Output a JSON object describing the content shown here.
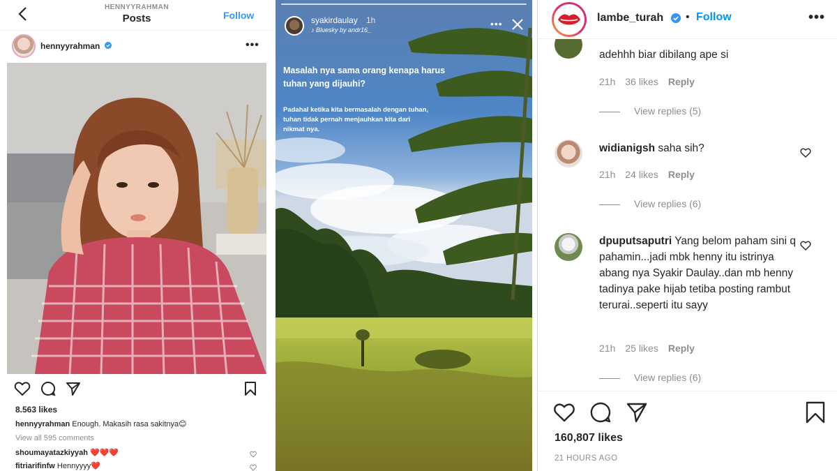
{
  "left_post": {
    "header_username": "HENNYYRAHMAN",
    "header_title": "Posts",
    "follow_label": "Follow",
    "username": "hennyyrahman",
    "likes": "8.563 likes",
    "caption_user": "hennyyrahman",
    "caption_text": " Enough. Makasih rasa sakitnya😊",
    "view_all": "View all 595 comments",
    "comments": [
      {
        "user": "shoumayatazkiyyah",
        "text": " ❤️❤️❤️"
      },
      {
        "user": "fitriarifinfw",
        "text": " Hennyyyy❤️"
      }
    ],
    "icons": [
      "back-arrow-icon",
      "verified-badge-icon",
      "more-options-icon",
      "heart-icon",
      "comment-icon",
      "share-icon",
      "bookmark-icon"
    ]
  },
  "story": {
    "username": "syakirdaulay",
    "time": "1h",
    "music": "♪ Bluesky by andr16_",
    "headline": "Masalah nya sama orang kenapa harus tuhan yang dijauhi?",
    "body": "Padahal ketika kita bermasalah dengan tuhan, tuhan tidak pernah menjauhkan kita dari nikmat nya.",
    "icons": [
      "more-options-icon",
      "close-icon"
    ]
  },
  "right_post": {
    "username": "lambe_turah",
    "dot": "•",
    "follow_label": "Follow",
    "comments": [
      {
        "user": "",
        "text": "adehhh biar dibilang ape si",
        "time": "21h",
        "likes": "36 likes",
        "reply": "Reply",
        "view_replies": "View replies (5)"
      },
      {
        "user": "widianigsh",
        "text": " saha sih?",
        "time": "21h",
        "likes": "24 likes",
        "reply": "Reply",
        "view_replies": "View replies (6)"
      },
      {
        "user": "dpuputsaputri",
        "text": " Yang belom paham sini q pahamin...jadi mbk henny itu istrinya abang nya Syakir Daulay..dan mb henny tadinya pake hijab tetiba posting rambut terurai..seperti itu sayy",
        "time": "21h",
        "likes": "25 likes",
        "reply": "Reply",
        "view_replies": "View replies (6)"
      }
    ],
    "likes": "160,807 likes",
    "time_ago": "21 HOURS AGO",
    "icons": [
      "verified-badge-icon",
      "more-options-icon",
      "heart-icon",
      "comment-icon",
      "share-icon",
      "bookmark-icon"
    ]
  },
  "colors": {
    "link_blue": "#0095f6",
    "text": "#262626",
    "muted": "#8e8e8e",
    "heart_red": "#ed4956"
  }
}
